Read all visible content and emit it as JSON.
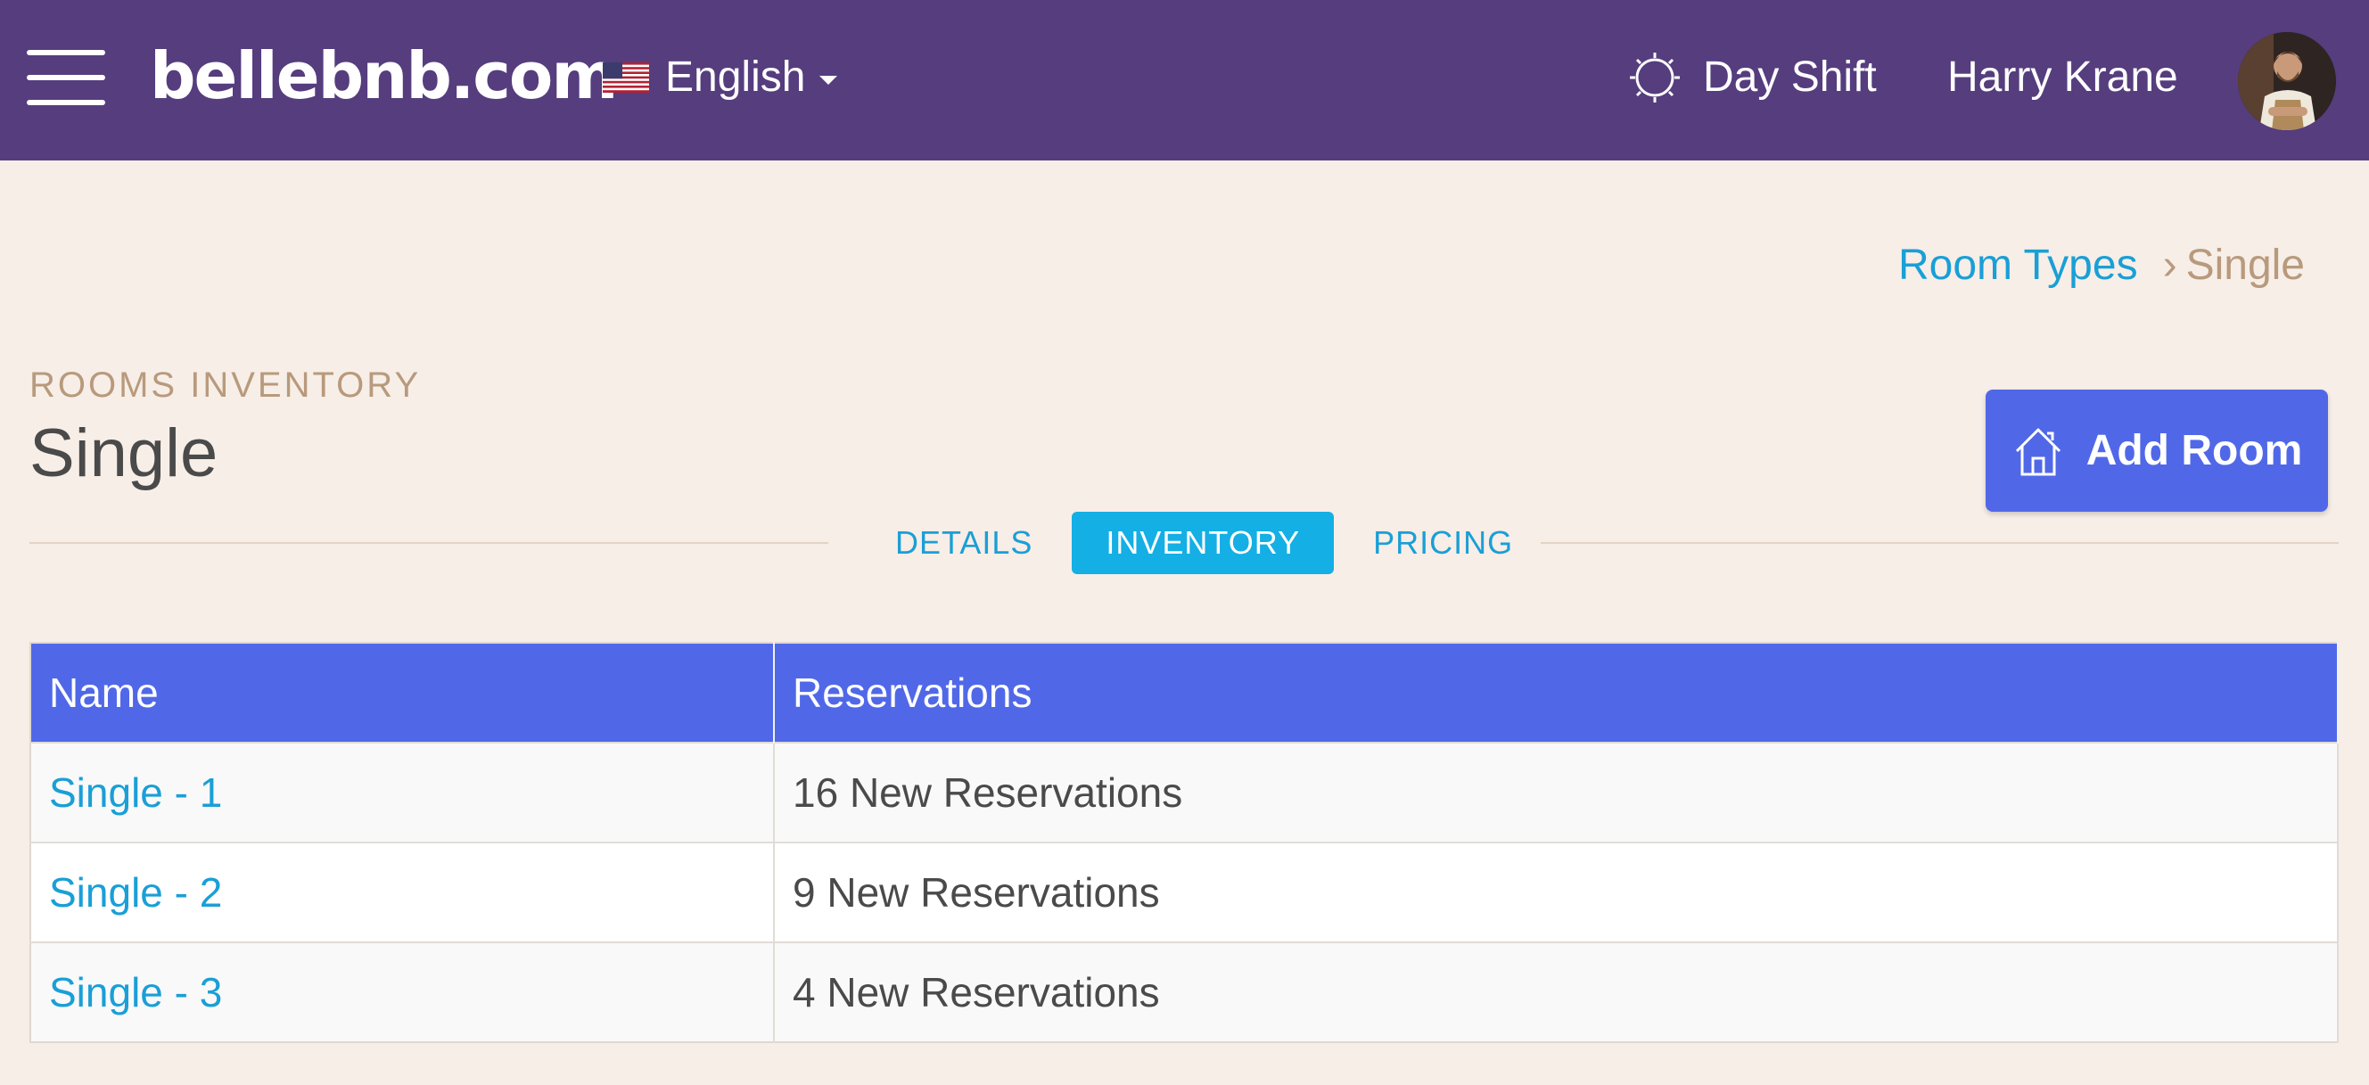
{
  "header": {
    "logo": "bellebnb.com",
    "language": "English",
    "shift": "Day Shift",
    "user_name": "Harry Krane"
  },
  "breadcrumb": {
    "parent": "Room Types",
    "separator": "›",
    "current": "Single"
  },
  "page": {
    "eyebrow": "ROOMS INVENTORY",
    "title": "Single",
    "add_button_label": "Add Room"
  },
  "tabs": [
    {
      "label": "DETAILS",
      "active": false
    },
    {
      "label": "INVENTORY",
      "active": true
    },
    {
      "label": "PRICING",
      "active": false
    }
  ],
  "table": {
    "columns": [
      "Name",
      "Reservations"
    ],
    "rows": [
      {
        "name": "Single - 1",
        "reservations": "16 New Reservations"
      },
      {
        "name": "Single - 2",
        "reservations": "9 New Reservations"
      },
      {
        "name": "Single - 3",
        "reservations": "4 New Reservations"
      }
    ]
  },
  "colors": {
    "topbar": "#553d7e",
    "background": "#f7eee8",
    "accent": "#5068e8",
    "link": "#1a9fd6",
    "active_tab": "#14afe4",
    "muted": "#b89a7c"
  },
  "icons": {
    "menu": "hamburger-icon",
    "flag": "us-flag-icon",
    "shift": "sun-icon",
    "add_room": "house-icon",
    "caret": "chevron-down-icon"
  }
}
